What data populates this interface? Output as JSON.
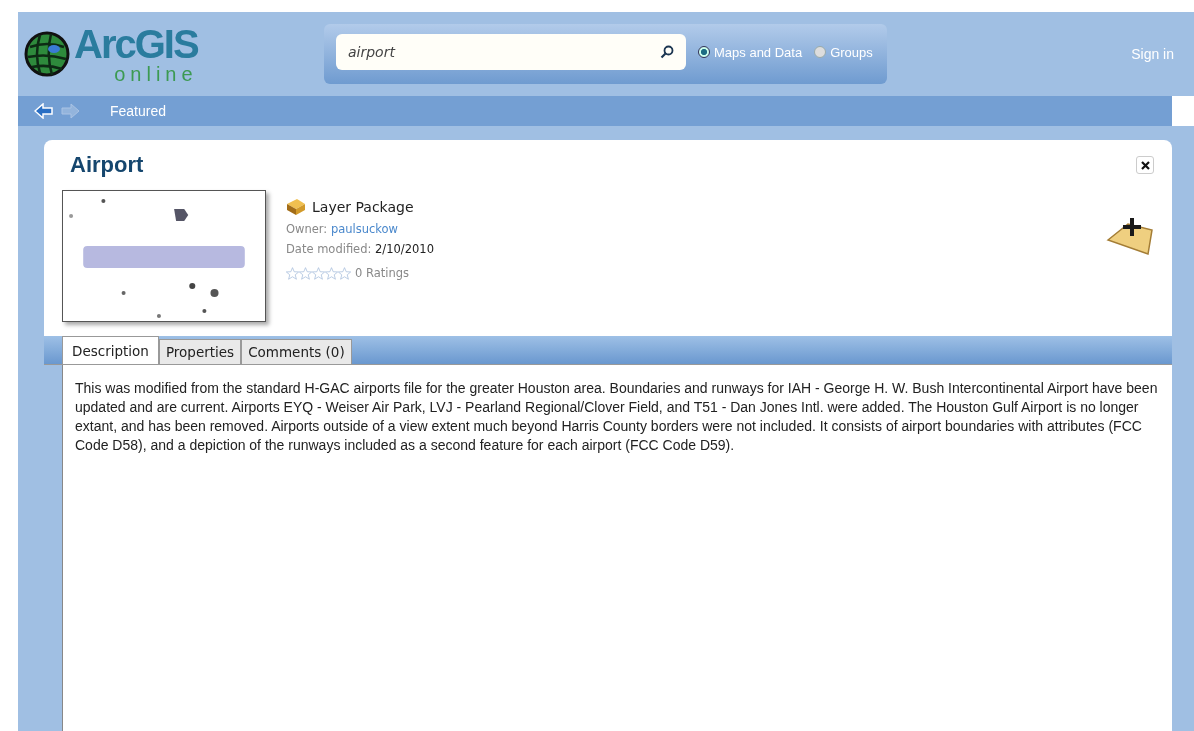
{
  "header": {
    "logo": {
      "title": "ArcGIS",
      "subtitle": "online"
    },
    "search": {
      "value": "airport"
    },
    "scope": [
      {
        "label": "Maps and Data",
        "selected": true
      },
      {
        "label": "Groups",
        "selected": false
      }
    ],
    "sign_in": "Sign in"
  },
  "nav": {
    "breadcrumb": "Featured"
  },
  "item": {
    "title": "Airport",
    "type": "Layer Package",
    "owner_label": "Owner:",
    "owner": "paulsuckow",
    "date_label": "Date modified:",
    "date": "2/10/2010",
    "stars": 0,
    "ratings": "0 Ratings"
  },
  "tabs": [
    {
      "label": "Description",
      "selected": true
    },
    {
      "label": "Properties",
      "selected": false
    },
    {
      "label": "Comments (0)",
      "selected": false
    }
  ],
  "description": "This was modified from the standard H-GAC airports file for the greater Houston area.  Boundaries and runways for IAH - George H. W. Bush Intercontinental Airport have been updated and are current. Airports EYQ - Weiser Air Park, LVJ - Pearland Regional/Clover Field, and T51 - Dan Jones Intl. were added.  The Houston Gulf Airport is no longer extant, and has been removed.  Airports outside of a view extent much beyond Harris County borders were not included.  It consists of airport boundaries with attributes (FCC Code D58), and a depiction of the runways included as a second feature for each airport (FCC Code D59)."
}
